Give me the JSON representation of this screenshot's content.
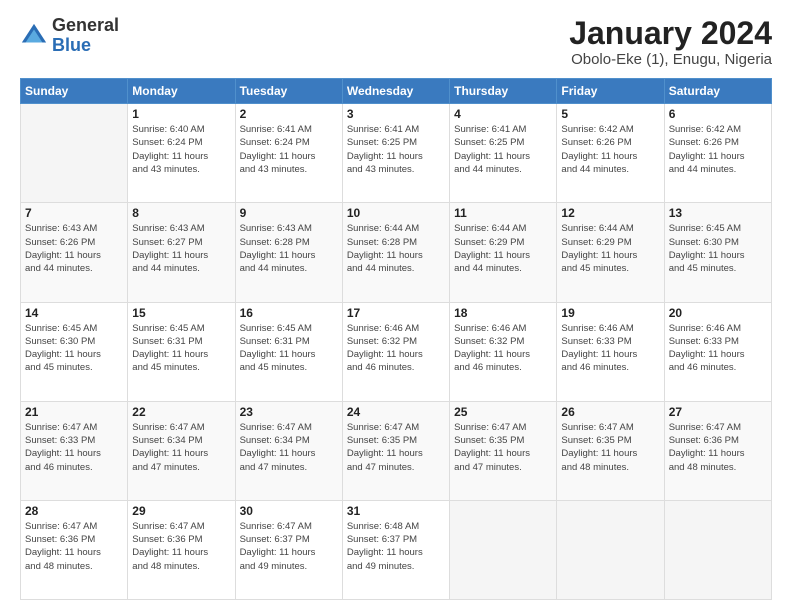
{
  "header": {
    "logo": {
      "general": "General",
      "blue": "Blue"
    },
    "title": "January 2024",
    "location": "Obolo-Eke (1), Enugu, Nigeria"
  },
  "calendar": {
    "days_of_week": [
      "Sunday",
      "Monday",
      "Tuesday",
      "Wednesday",
      "Thursday",
      "Friday",
      "Saturday"
    ],
    "weeks": [
      [
        {
          "day": "",
          "info": ""
        },
        {
          "day": "1",
          "info": "Sunrise: 6:40 AM\nSunset: 6:24 PM\nDaylight: 11 hours\nand 43 minutes."
        },
        {
          "day": "2",
          "info": "Sunrise: 6:41 AM\nSunset: 6:24 PM\nDaylight: 11 hours\nand 43 minutes."
        },
        {
          "day": "3",
          "info": "Sunrise: 6:41 AM\nSunset: 6:25 PM\nDaylight: 11 hours\nand 43 minutes."
        },
        {
          "day": "4",
          "info": "Sunrise: 6:41 AM\nSunset: 6:25 PM\nDaylight: 11 hours\nand 44 minutes."
        },
        {
          "day": "5",
          "info": "Sunrise: 6:42 AM\nSunset: 6:26 PM\nDaylight: 11 hours\nand 44 minutes."
        },
        {
          "day": "6",
          "info": "Sunrise: 6:42 AM\nSunset: 6:26 PM\nDaylight: 11 hours\nand 44 minutes."
        }
      ],
      [
        {
          "day": "7",
          "info": "Sunrise: 6:43 AM\nSunset: 6:26 PM\nDaylight: 11 hours\nand 44 minutes."
        },
        {
          "day": "8",
          "info": "Sunrise: 6:43 AM\nSunset: 6:27 PM\nDaylight: 11 hours\nand 44 minutes."
        },
        {
          "day": "9",
          "info": "Sunrise: 6:43 AM\nSunset: 6:28 PM\nDaylight: 11 hours\nand 44 minutes."
        },
        {
          "day": "10",
          "info": "Sunrise: 6:44 AM\nSunset: 6:28 PM\nDaylight: 11 hours\nand 44 minutes."
        },
        {
          "day": "11",
          "info": "Sunrise: 6:44 AM\nSunset: 6:29 PM\nDaylight: 11 hours\nand 44 minutes."
        },
        {
          "day": "12",
          "info": "Sunrise: 6:44 AM\nSunset: 6:29 PM\nDaylight: 11 hours\nand 45 minutes."
        },
        {
          "day": "13",
          "info": "Sunrise: 6:45 AM\nSunset: 6:30 PM\nDaylight: 11 hours\nand 45 minutes."
        }
      ],
      [
        {
          "day": "14",
          "info": "Sunrise: 6:45 AM\nSunset: 6:30 PM\nDaylight: 11 hours\nand 45 minutes."
        },
        {
          "day": "15",
          "info": "Sunrise: 6:45 AM\nSunset: 6:31 PM\nDaylight: 11 hours\nand 45 minutes."
        },
        {
          "day": "16",
          "info": "Sunrise: 6:45 AM\nSunset: 6:31 PM\nDaylight: 11 hours\nand 45 minutes."
        },
        {
          "day": "17",
          "info": "Sunrise: 6:46 AM\nSunset: 6:32 PM\nDaylight: 11 hours\nand 46 minutes."
        },
        {
          "day": "18",
          "info": "Sunrise: 6:46 AM\nSunset: 6:32 PM\nDaylight: 11 hours\nand 46 minutes."
        },
        {
          "day": "19",
          "info": "Sunrise: 6:46 AM\nSunset: 6:33 PM\nDaylight: 11 hours\nand 46 minutes."
        },
        {
          "day": "20",
          "info": "Sunrise: 6:46 AM\nSunset: 6:33 PM\nDaylight: 11 hours\nand 46 minutes."
        }
      ],
      [
        {
          "day": "21",
          "info": "Sunrise: 6:47 AM\nSunset: 6:33 PM\nDaylight: 11 hours\nand 46 minutes."
        },
        {
          "day": "22",
          "info": "Sunrise: 6:47 AM\nSunset: 6:34 PM\nDaylight: 11 hours\nand 47 minutes."
        },
        {
          "day": "23",
          "info": "Sunrise: 6:47 AM\nSunset: 6:34 PM\nDaylight: 11 hours\nand 47 minutes."
        },
        {
          "day": "24",
          "info": "Sunrise: 6:47 AM\nSunset: 6:35 PM\nDaylight: 11 hours\nand 47 minutes."
        },
        {
          "day": "25",
          "info": "Sunrise: 6:47 AM\nSunset: 6:35 PM\nDaylight: 11 hours\nand 47 minutes."
        },
        {
          "day": "26",
          "info": "Sunrise: 6:47 AM\nSunset: 6:35 PM\nDaylight: 11 hours\nand 48 minutes."
        },
        {
          "day": "27",
          "info": "Sunrise: 6:47 AM\nSunset: 6:36 PM\nDaylight: 11 hours\nand 48 minutes."
        }
      ],
      [
        {
          "day": "28",
          "info": "Sunrise: 6:47 AM\nSunset: 6:36 PM\nDaylight: 11 hours\nand 48 minutes."
        },
        {
          "day": "29",
          "info": "Sunrise: 6:47 AM\nSunset: 6:36 PM\nDaylight: 11 hours\nand 48 minutes."
        },
        {
          "day": "30",
          "info": "Sunrise: 6:47 AM\nSunset: 6:37 PM\nDaylight: 11 hours\nand 49 minutes."
        },
        {
          "day": "31",
          "info": "Sunrise: 6:48 AM\nSunset: 6:37 PM\nDaylight: 11 hours\nand 49 minutes."
        },
        {
          "day": "",
          "info": ""
        },
        {
          "day": "",
          "info": ""
        },
        {
          "day": "",
          "info": ""
        }
      ]
    ]
  }
}
